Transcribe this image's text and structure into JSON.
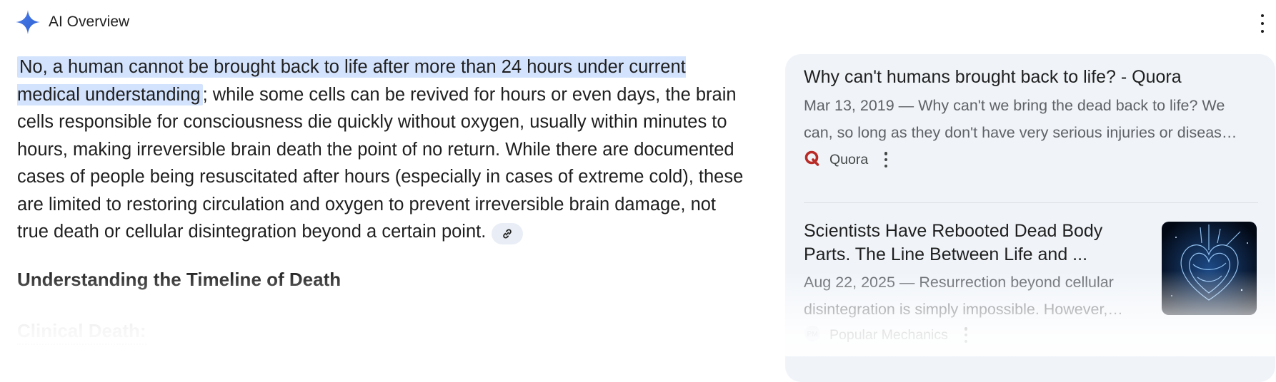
{
  "header": {
    "title": "AI Overview",
    "icon": "gemini-sparkle-icon",
    "accent": "#4285f4"
  },
  "answer": {
    "highlight": "No, a human cannot be brought back to life after more than 24 hours under current medical understanding",
    "rest": "; while some cells can be revived for hours or even days, the brain cells responsible for consciousness die quickly without oxygen, usually within minutes to hours, making irreversible brain death the point of no return. While there are documented cases of people being resuscitated after hours (especially in cases of extreme cold), these are limited to restoring circulation and oxygen to prevent irreversible brain damage, not true death or cellular disintegration beyond a certain point."
  },
  "section_heading": "Understanding the Timeline of Death",
  "faded_heading": "Clinical Death:",
  "sources": [
    {
      "title": "Why can't humans brought back to life? - Quora",
      "snippet_line1": "Mar 13, 2019 — Why can't we bring the dead back to life? We",
      "snippet_line2": "can, so long as they don't have very serious injuries or diseas…",
      "source": "Quora",
      "favicon_color": "#b92b27"
    },
    {
      "title_line1": "Scientists Have Rebooted Dead Body",
      "title_line2": "Parts. The Line Between Life and ...",
      "snippet_line1": "Aug 22, 2025 — Resurrection beyond cellular",
      "snippet_line2": "disintegration is simply impossible. However,…",
      "source": "Popular Mechanics",
      "thumbnail": "glowing-heart-image"
    }
  ],
  "colors": {
    "highlight_bg": "#d3e3fd",
    "panel_bg": "#f0f4f9"
  }
}
